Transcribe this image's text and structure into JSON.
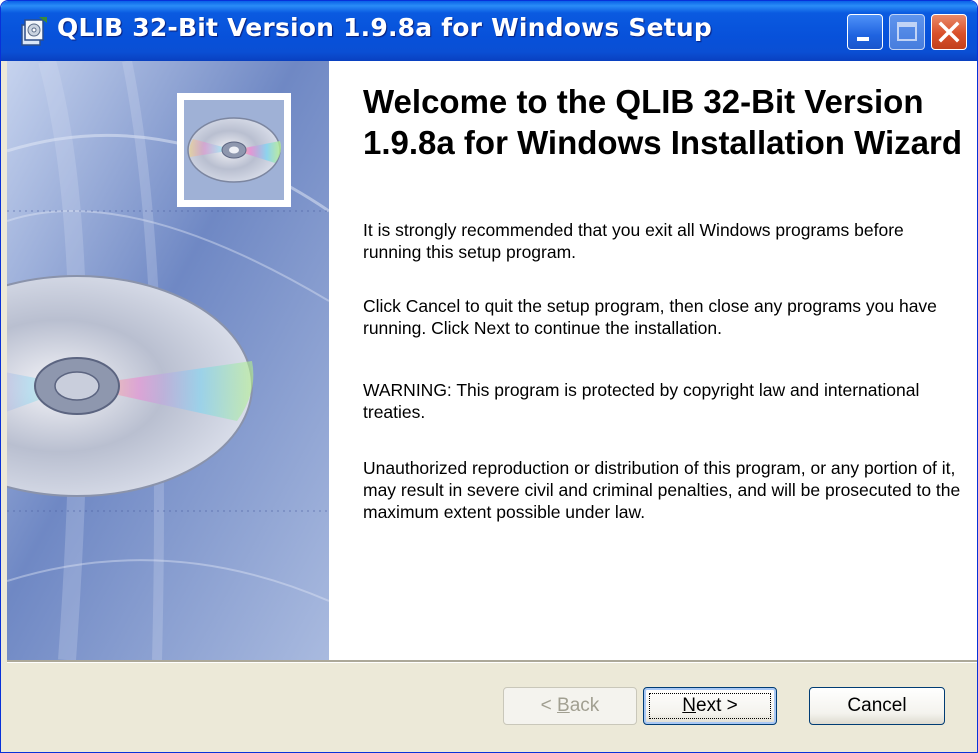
{
  "window": {
    "title": "QLIB 32-Bit Version 1.9.8a for Windows Setup",
    "title_bar_color": "#0a5ae0",
    "controls": [
      "minimize-icon",
      "maximize-icon",
      "close-icon"
    ]
  },
  "content": {
    "heading": "Welcome to the QLIB 32-Bit Version 1.9.8a for Windows Installation Wizard",
    "paragraphs": [
      "It is strongly recommended that you exit all Windows programs before running this setup program.",
      "Click Cancel to quit the setup program, then close any programs you have running.  Click Next to continue the installation.",
      "WARNING: This program is protected by copyright law and international treaties.",
      "Unauthorized reproduction or distribution of this program, or any portion of it, may result in severe civil and criminal penalties, and will be prosecuted to the maximum extent possible under law."
    ]
  },
  "buttons": {
    "back": {
      "prefix": "< ",
      "accel": "B",
      "rest": "ack",
      "enabled": false
    },
    "next": {
      "accel": "N",
      "rest": "ext >",
      "enabled": true
    },
    "cancel": {
      "label": "Cancel",
      "enabled": true
    }
  },
  "side_image": {
    "icon": "cd-disc-icon"
  }
}
